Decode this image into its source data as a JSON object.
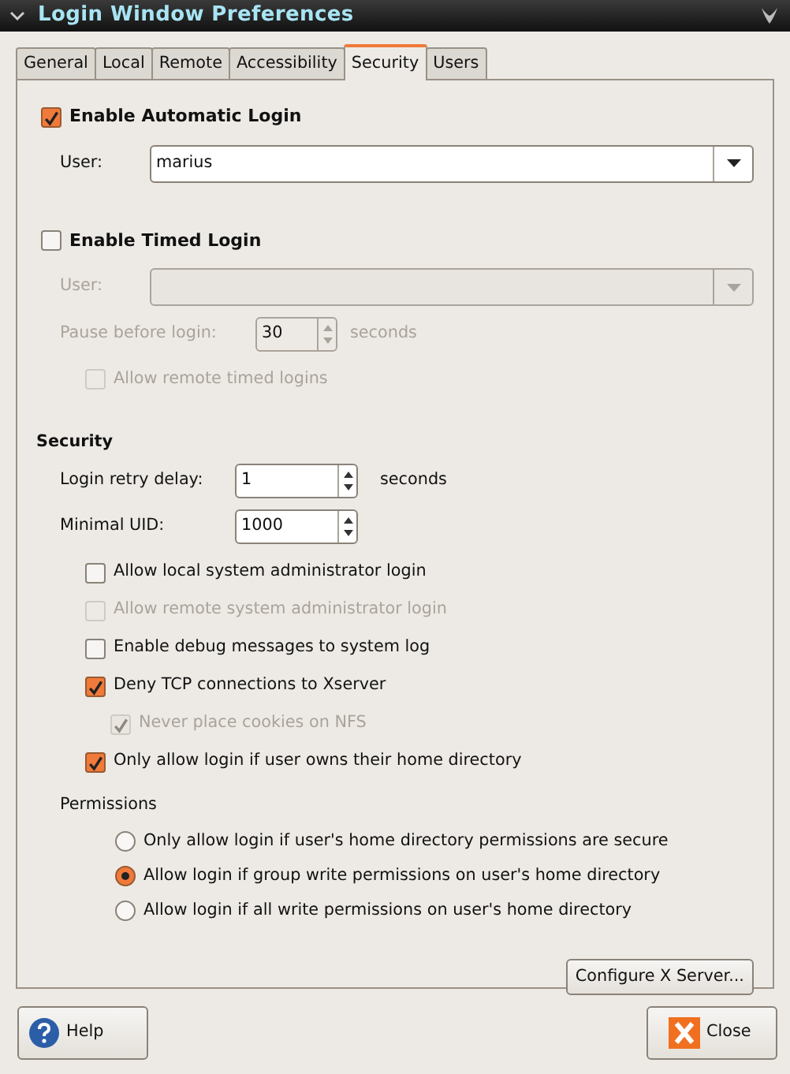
{
  "window": {
    "title": "Login Window Preferences"
  },
  "tabs": [
    {
      "label": "General",
      "selected": false
    },
    {
      "label": "Local",
      "selected": false
    },
    {
      "label": "Remote",
      "selected": false
    },
    {
      "label": "Accessibility",
      "selected": false
    },
    {
      "label": "Security",
      "selected": true
    },
    {
      "label": "Users",
      "selected": false
    }
  ],
  "automatic_login": {
    "label": "Enable Automatic Login",
    "checked": true,
    "user_label": "User:",
    "user_value": "marius"
  },
  "timed_login": {
    "label": "Enable Timed Login",
    "checked": false,
    "disabled": true,
    "user_label": "User:",
    "pause_label": "Pause before login:",
    "pause_value": "30",
    "pause_unit": "seconds",
    "allow_remote": {
      "label": "Allow remote timed logins",
      "checked": false
    }
  },
  "security": {
    "heading": "Security",
    "retry_label": "Login retry delay:",
    "retry_value": "1",
    "retry_unit": "seconds",
    "uid_label": "Minimal UID:",
    "uid_value": "1000",
    "options": [
      {
        "label": "Allow local system administrator login",
        "checked": false,
        "disabled": false
      },
      {
        "label": "Allow remote system administrator login",
        "checked": false,
        "disabled": true
      },
      {
        "label": "Enable debug messages to system log",
        "checked": false,
        "disabled": false
      },
      {
        "label": "Deny TCP connections to Xserver",
        "checked": true,
        "disabled": false,
        "children": [
          {
            "label": "Never place cookies on NFS",
            "checked": true,
            "disabled": true
          }
        ]
      },
      {
        "label": "Only allow login if user owns their home directory",
        "checked": true,
        "disabled": false
      }
    ]
  },
  "permissions": {
    "heading": "Permissions",
    "options": [
      {
        "label": "Only allow login if user's home directory permissions are secure",
        "selected": false
      },
      {
        "label": "Allow login if group write permissions on user's home directory",
        "selected": true
      },
      {
        "label": "Allow login if all write permissions on user's home directory",
        "selected": false
      }
    ]
  },
  "configure_button": "Configure X Server...",
  "help_button": "Help",
  "close_button": "Close"
}
